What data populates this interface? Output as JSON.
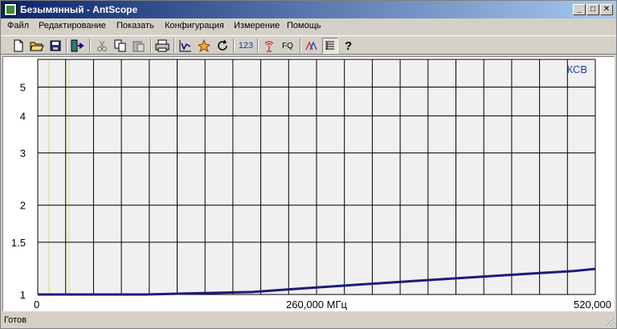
{
  "window": {
    "title": "Безымянный - AntScope"
  },
  "menu": [
    "Файл",
    "Редактирование",
    "Показать",
    "Конфигурация",
    "Измерение",
    "Помощь"
  ],
  "toolbar": {
    "btn_123": "123",
    "btn_fq": "FQ"
  },
  "status": {
    "text": "Готов"
  },
  "colors": {
    "trace": "#1c1c7a",
    "plot_bg": "#f0f0f0",
    "grid": "#000000",
    "marker": "#e8e4b0"
  },
  "chart_data": {
    "type": "line",
    "title": "КСВ",
    "y_tick_labels": [
      "1",
      "1.5",
      "2",
      "3",
      "4",
      "5"
    ],
    "y_ticks": [
      1,
      1.5,
      2,
      3,
      4,
      5
    ],
    "ylim": [
      1,
      6.2
    ],
    "y_scale": "log",
    "x_tick_labels": [
      "0",
      "260,000 МГц",
      "520,000"
    ],
    "xlim": [
      0,
      520
    ],
    "grid": true,
    "series": [
      {
        "x": [
          0,
          50,
          100,
          150,
          200,
          250,
          300,
          350,
          400,
          450,
          500,
          520
        ],
        "y": [
          1.0,
          1.0,
          1.0,
          1.01,
          1.02,
          1.05,
          1.08,
          1.11,
          1.14,
          1.17,
          1.2,
          1.22
        ]
      }
    ]
  }
}
